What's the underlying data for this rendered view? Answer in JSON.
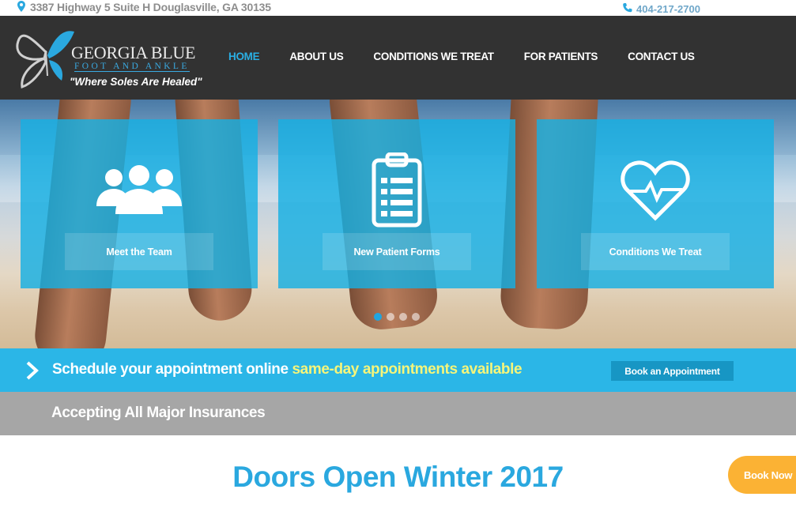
{
  "topbar": {
    "address": "3387 Highway 5 Suite H Douglasville, GA 30135",
    "phone": "404-217-2700",
    "address_icon": "map-pin-icon",
    "phone_icon": "phone-icon"
  },
  "logo": {
    "line1": "GEORGIA BLUE",
    "line2": "FOOT AND ANKLE",
    "tagline": "\"Where Soles Are Healed\"",
    "icon": "butterfly-icon"
  },
  "nav": {
    "items": [
      {
        "label": "HOME",
        "active": true
      },
      {
        "label": "ABOUT US",
        "active": false
      },
      {
        "label": "CONDITIONS WE TREAT",
        "active": false
      },
      {
        "label": "FOR PATIENTS",
        "active": false
      },
      {
        "label": "CONTACT US",
        "active": false
      }
    ]
  },
  "hero": {
    "cards": [
      {
        "label": "Meet the Team",
        "icon": "people-icon"
      },
      {
        "label": "New Patient Forms",
        "icon": "clipboard-icon"
      },
      {
        "label": "Conditions We Treat",
        "icon": "heart-pulse-icon"
      }
    ],
    "slides_total": 4,
    "slide_active": 1
  },
  "schedule": {
    "text": "Schedule your appointment online",
    "highlight": "same-day appointments available",
    "button": "Book an Appointment",
    "icon": "chevron-right-icon"
  },
  "insurance": {
    "text": "Accepting All Major Insurances"
  },
  "main": {
    "headline": "Doors Open Winter 2017",
    "book_now": "Book Now"
  },
  "colors": {
    "brand_blue": "#2aa8df",
    "header_dark": "#323232",
    "accent_yellow": "#f5f57a",
    "book_now_orange": "#fbb234"
  }
}
